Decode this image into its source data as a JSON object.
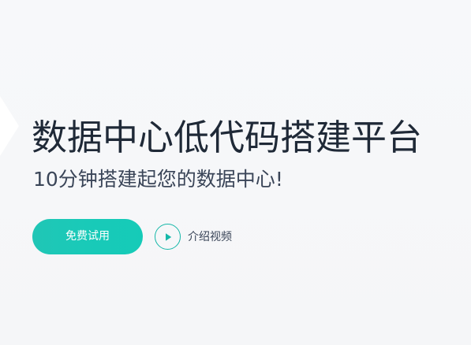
{
  "hero": {
    "title": "数据中心低代码搭建平台",
    "subtitle": "10分钟搭建起您的数据中心!",
    "primary_button_label": "免费试用",
    "video_link_label": "介绍视频",
    "video_icon": "play-icon"
  },
  "colors": {
    "accent": "#15cbb8",
    "text_primary": "#1f2937",
    "text_secondary": "#3a4558",
    "background": "#f6f7f9"
  }
}
